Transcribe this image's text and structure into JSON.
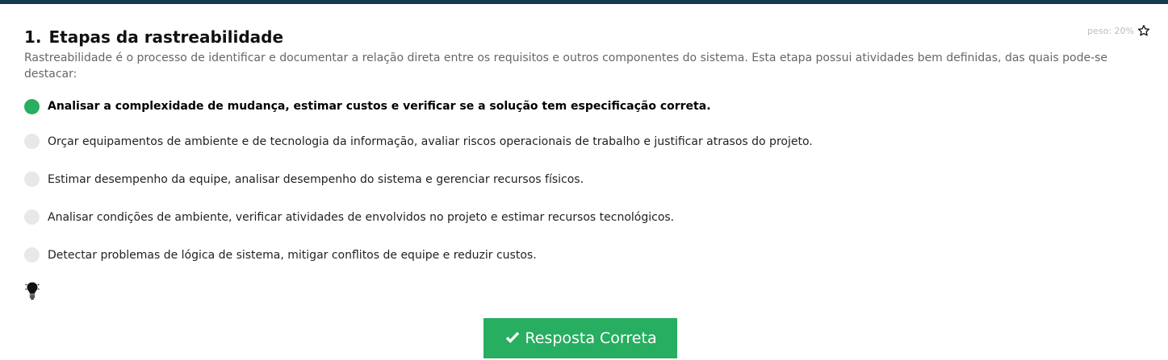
{
  "question": {
    "number": "1.",
    "title": "Etapas da rastreabilidade",
    "weight": "peso: 20%",
    "description": "Rastreabilidade é o processo de identificar e documentar a relação direta entre os requisitos e outros componentes do sistema. Esta etapa possui atividades bem definidas, das quais pode-se destacar:",
    "options": [
      {
        "label": "Analisar a complexidade de mudança, estimar custos e verificar se a solução tem especificação correta.",
        "selected": true
      },
      {
        "label": "Orçar equipamentos de ambiente e de tecnologia da informação, avaliar riscos operacionais de trabalho e justificar atrasos do projeto.",
        "selected": false
      },
      {
        "label": "Estimar desempenho da equipe, analisar desempenho do sistema e gerenciar recursos físicos.",
        "selected": false
      },
      {
        "label": "Analisar condições de ambiente, verificar atividades de envolvidos no projeto e estimar recursos tecnológicos.",
        "selected": false
      },
      {
        "label": "Detectar problemas de lógica de sistema, mitigar conflitos de equipe e reduzir custos.",
        "selected": false
      }
    ]
  },
  "answer_button": {
    "label": "Resposta Correta"
  },
  "icons": {
    "favorite": "star-icon",
    "hint": "lightbulb-icon",
    "answer": "check-icon"
  },
  "colors": {
    "top_bar": "#143a4f",
    "accent_green": "#27ae60",
    "radio_unselected": "#e6e8ea",
    "description_text": "#666666"
  }
}
